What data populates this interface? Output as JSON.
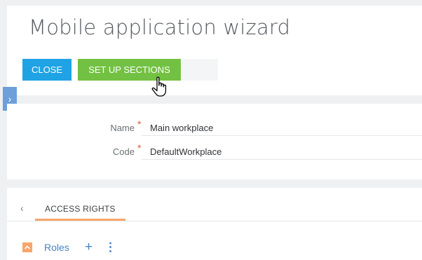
{
  "header": {
    "title": "Mobile application wizard",
    "close_label": "CLOSE",
    "setup_label": "SET UP SECTIONS"
  },
  "side_toggle": {
    "glyph": "›"
  },
  "form": {
    "name": {
      "label": "Name",
      "required_mark": "*",
      "value": "Main workplace"
    },
    "code": {
      "label": "Code",
      "required_mark": "*",
      "value": "DefaultWorkplace"
    }
  },
  "details": {
    "back_glyph": "‹",
    "tab_label": "ACCESS RIGHTS",
    "roles": {
      "label": "Roles",
      "add_glyph": "+",
      "menu_glyph": "⋮"
    }
  },
  "colors": {
    "close_button": "#1fa3e4",
    "setup_button": "#73c142",
    "accent": "#f7a66b",
    "link": "#4684c7"
  },
  "icons": [
    "hand-pointer-icon",
    "chevron-right-icon",
    "chevron-left-icon",
    "collapse-icon",
    "plus-icon",
    "kebab-menu-icon"
  ]
}
